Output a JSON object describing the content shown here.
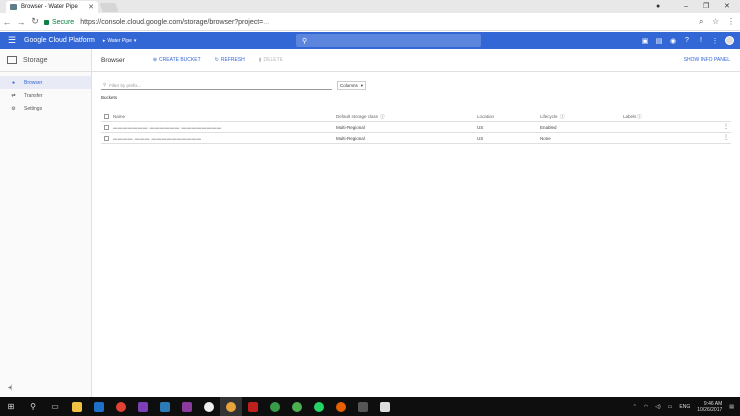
{
  "browser": {
    "tab_title": "Browser - Water Pipe",
    "secure_label": "Secure",
    "url": "https://console.cloud.google.com/storage/browser?project=",
    "url_rest": "..."
  },
  "header": {
    "brand": "Google Cloud Platform",
    "project": "Water Pipe"
  },
  "sidebar": {
    "title": "Storage",
    "items": [
      {
        "label": "Browser",
        "icon": "bucket-icon"
      },
      {
        "label": "Transfer",
        "icon": "transfer-icon"
      },
      {
        "label": "Settings",
        "icon": "gear-icon"
      }
    ]
  },
  "toolbar": {
    "title": "Browser",
    "create": "CREATE BUCKET",
    "refresh": "REFRESH",
    "delete": "DELETE",
    "info_panel": "SHOW INFO PANEL"
  },
  "filter": {
    "placeholder": "Filter by prefix...",
    "columns": "Columns"
  },
  "buckets_label": "Buckets",
  "table": {
    "headers": [
      "Name",
      "Default storage class",
      "Location",
      "Lifecycle",
      "Labels"
    ],
    "rows": [
      {
        "name": "",
        "storage": "Multi-Regional",
        "location": "US",
        "lifecycle": "Enabled",
        "labels": ""
      },
      {
        "name": "",
        "storage": "Multi-Regional",
        "location": "US",
        "lifecycle": "None",
        "labels": ""
      }
    ]
  },
  "taskbar": {
    "lang": "ENG",
    "time": "9:46 AM",
    "date": "10/26/2017"
  }
}
